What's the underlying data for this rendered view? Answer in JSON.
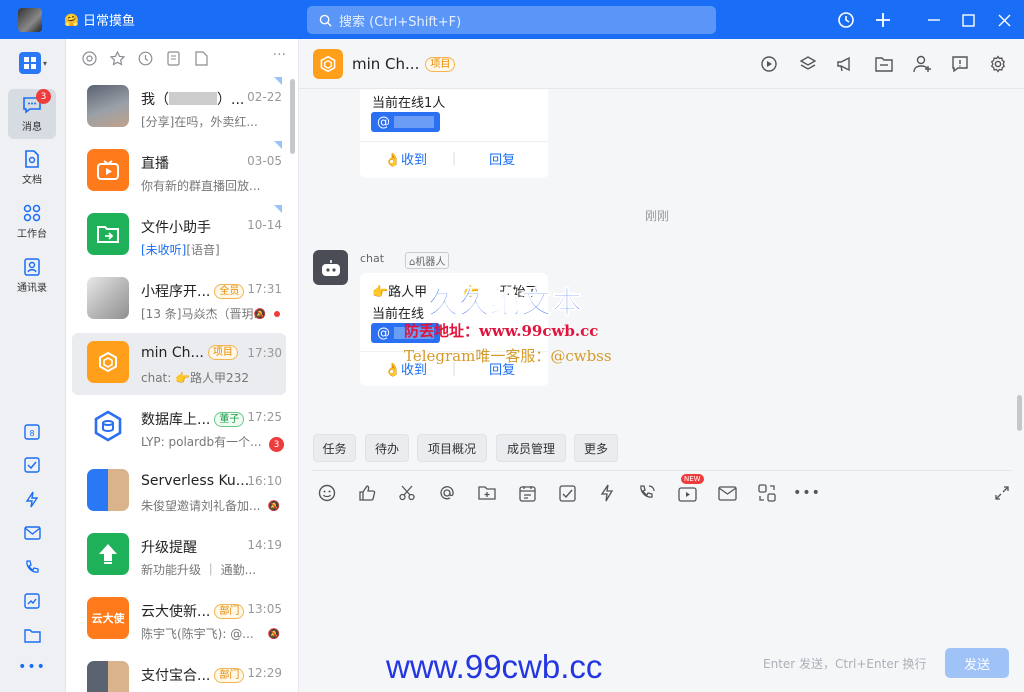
{
  "titlebar": {
    "status": "日常摸鱼",
    "search_placeholder": "搜索 (Ctrl+Shift+F)"
  },
  "nav": {
    "items": [
      {
        "label": "消息",
        "badge": "3"
      },
      {
        "label": "文档"
      },
      {
        "label": "工作台"
      },
      {
        "label": "通讯录"
      }
    ],
    "calendar_day": "8"
  },
  "list": {
    "conversations": [
      {
        "name": "我（",
        "name_tail": "）...",
        "time": "02-22",
        "preview": "[分享]在吗，外卖红..."
      },
      {
        "name": "直播",
        "time": "03-05",
        "preview": "你有新的群直播回放..."
      },
      {
        "name": "文件小助手",
        "time": "10-14",
        "preview_link": "[未收听]",
        "preview": "[语音]"
      },
      {
        "name": "小程序开...",
        "tag": "全员",
        "time": "17:31",
        "preview": "[13 条]马焱杰（晋玥..."
      },
      {
        "name": "min Ch...",
        "tag": "项目",
        "time": "17:30",
        "preview": "chat: 👉路人甲232"
      },
      {
        "name": "数据库上...",
        "tag": "董子",
        "time": "17:25",
        "preview": "LYP: polardb有一个...",
        "badge": "3"
      },
      {
        "name": "Serverless Ku...",
        "time": "16:10",
        "preview": "朱俊望邀请刘礼备加..."
      },
      {
        "name": "升级提醒",
        "time": "14:19",
        "preview": "新功能升级 ｜ 通勤..."
      },
      {
        "name": "云大使新...",
        "tag": "部门",
        "time": "13:05",
        "preview": "陈宇飞(陈宇飞): @...",
        "ava_text": "云大使"
      },
      {
        "name": "支付宝合...",
        "tag": "部门",
        "time": "12:29",
        "preview": ""
      }
    ]
  },
  "chat": {
    "title": "min Ch...",
    "title_tag": "项目",
    "msg1": {
      "line": "当前在线1人",
      "mention": "@",
      "ack": "👌收到",
      "reply": "回复"
    },
    "divider_time": "刚刚",
    "bot": {
      "name": "chat",
      "tag": "机器人"
    },
    "msg2": {
      "line1": "👉路人甲",
      "line1b": "👉",
      "line1c": "开始了",
      "line2": "当前在线",
      "mention": "@",
      "ack": "👌收到",
      "reply": "回复"
    },
    "quick": [
      "任务",
      "待办",
      "项目概况",
      "成员管理",
      "更多"
    ],
    "new_badge": "NEW",
    "hint": "Enter 发送，Ctrl+Enter 换行",
    "send": "发送"
  },
  "watermark": {
    "brand": "久久绝文本",
    "anti_lost": "防丢地址：www.99cwb.cc",
    "telegram": "Telegram唯一客服：@cwbss",
    "url": "www.99cwb.cc"
  },
  "colors": {
    "brand": "#1a6ef5",
    "badge": "#ee3b3b",
    "project": "#ff9f1a"
  }
}
